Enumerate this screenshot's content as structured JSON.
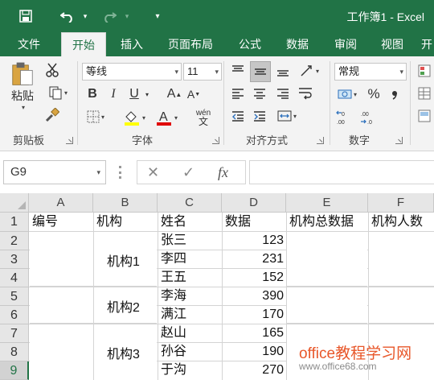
{
  "window": {
    "title": "工作簿1 - Excel"
  },
  "quick_access": {
    "save_icon": "save-icon",
    "undo_icon": "undo-icon",
    "redo_icon": "redo-icon",
    "customize_icon": "customize-dropdown-icon"
  },
  "tabs": [
    "文件",
    "开始",
    "插入",
    "页面布局",
    "公式",
    "数据",
    "审阅",
    "视图",
    "开"
  ],
  "active_tab": "开始",
  "ribbon": {
    "clipboard": {
      "paste_label": "粘贴",
      "group_label": "剪贴板"
    },
    "font": {
      "font_name": "等线",
      "font_size": "11",
      "bold": "B",
      "italic": "I",
      "underline": "U",
      "grow": "A",
      "shrink": "A",
      "wen": "wén",
      "wen_sub": "文",
      "group_label": "字体"
    },
    "alignment": {
      "group_label": "对齐方式"
    },
    "number": {
      "format": "常规",
      "percent": "%",
      "group_label": "数字"
    }
  },
  "formula_bar": {
    "name_box": "G9",
    "cancel": "✕",
    "enter": "✓",
    "fx": "fx",
    "value": ""
  },
  "sheet": {
    "columns": [
      "A",
      "B",
      "C",
      "D",
      "E",
      "F"
    ],
    "rows": [
      "1",
      "2",
      "3",
      "4",
      "5",
      "6",
      "7",
      "8",
      "9"
    ],
    "selected_row": "9",
    "header_row": [
      "编号",
      "机构",
      "姓名",
      "数据",
      "机构总数据",
      "机构人数"
    ],
    "records": [
      {
        "name": "张三",
        "value": "123"
      },
      {
        "name": "李四",
        "value": "231"
      },
      {
        "name": "王五",
        "value": "152"
      },
      {
        "name": "李海",
        "value": "390"
      },
      {
        "name": "满江",
        "value": "170"
      },
      {
        "name": "赵山",
        "value": "165"
      },
      {
        "name": "孙谷",
        "value": "190"
      },
      {
        "name": "于沟",
        "value": "270"
      }
    ],
    "merged_orgs": [
      "机构1",
      "机构2",
      "机构3"
    ]
  },
  "watermark": {
    "main": "office教程学习网",
    "url": "www.office68.com"
  },
  "colors": {
    "excel_green": "#217346",
    "ribbon_bg": "#f3f3f3",
    "header_bg": "#e6e6e6",
    "gridline": "#d4d4d4",
    "watermark": "#e8572a"
  }
}
